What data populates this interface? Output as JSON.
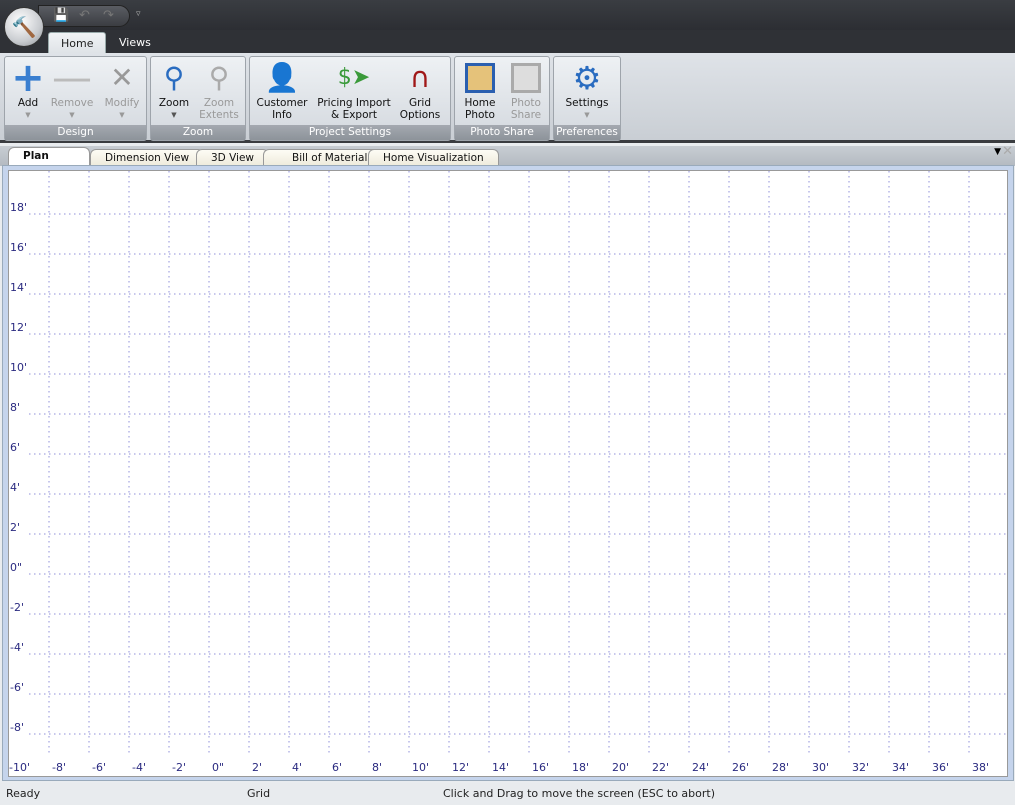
{
  "quick_access": {
    "icons": [
      "save-icon",
      "undo-icon",
      "redo-icon",
      "customize-icon"
    ]
  },
  "ribbon_tabs": [
    {
      "label": "Home",
      "active": true
    },
    {
      "label": "Views",
      "active": false
    }
  ],
  "groups": {
    "design": {
      "label": "Design",
      "buttons": [
        {
          "label": "Add",
          "enabled": true
        },
        {
          "label": "Remove",
          "enabled": false
        },
        {
          "label": "Modify",
          "enabled": false
        }
      ]
    },
    "zoom": {
      "label": "Zoom",
      "buttons": [
        {
          "label": "Zoom",
          "enabled": true
        },
        {
          "label": "Zoom Extents",
          "enabled": false
        }
      ]
    },
    "project_settings": {
      "label": "Project Settings",
      "buttons": [
        {
          "label": "Customer Info"
        },
        {
          "label": "Pricing Import & Export"
        },
        {
          "label": "Grid Options"
        }
      ]
    },
    "photo_share": {
      "label": "Photo Share",
      "buttons": [
        {
          "label": "Home Photo",
          "enabled": true
        },
        {
          "label": "Photo Share",
          "enabled": false
        }
      ]
    },
    "preferences": {
      "label": "Preferences",
      "buttons": [
        {
          "label": "Settings"
        }
      ]
    }
  },
  "doc_tabs": [
    {
      "label": "Plan View",
      "active": true
    },
    {
      "label": "Dimension View"
    },
    {
      "label": "3D View"
    },
    {
      "label": "Bill of Materials"
    },
    {
      "label": "Home Visualization"
    }
  ],
  "grid": {
    "x_labels": [
      "-10'",
      "-8'",
      "-6'",
      "-4'",
      "-2'",
      "0\"",
      "2'",
      "4'",
      "6'",
      "8'",
      "10'",
      "12'",
      "14'",
      "16'",
      "18'",
      "20'",
      "22'",
      "24'",
      "26'",
      "28'",
      "30'",
      "32'",
      "34'",
      "36'",
      "38'"
    ],
    "y_labels": [
      "18'",
      "16'",
      "14'",
      "12'",
      "10'",
      "8'",
      "6'",
      "4'",
      "2'",
      "0\"",
      "-2'",
      "-4'",
      "-6'",
      "-8'"
    ],
    "line_color": "#8f8fd8",
    "label_color": "#2a2a80"
  },
  "status": {
    "left": "Ready",
    "mode": "Grid",
    "hint": "Click and Drag to move the screen  (ESC to abort)"
  }
}
